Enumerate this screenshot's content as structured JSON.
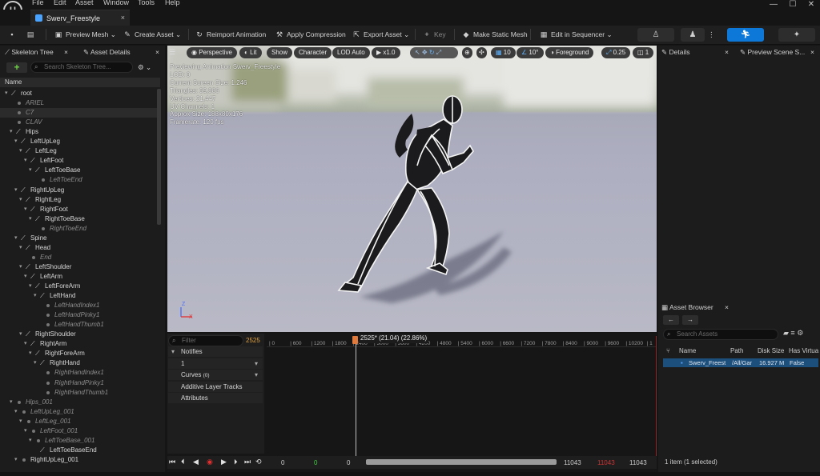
{
  "menu": [
    "File",
    "Edit",
    "Asset",
    "Window",
    "Tools",
    "Help"
  ],
  "app": {
    "logo": "U"
  },
  "window_controls": {
    "minimize": "—",
    "maximize": "☐",
    "close": "✕"
  },
  "document_tab": {
    "title": "Swerv_Freestyle",
    "close": "×"
  },
  "toolbar": {
    "save_icon": "floppy-icon",
    "preview_mesh": "Preview Mesh",
    "create_asset": "Create Asset",
    "reimport": "Reimport Animation",
    "apply_compression": "Apply Compression",
    "export_asset": "Export Asset",
    "key": "Key",
    "make_static_mesh": "Make Static Mesh",
    "edit_in_sequencer": "Edit in Sequencer"
  },
  "left_panel": {
    "tab_skeleton": "Skeleton Tree",
    "tab_details": "Asset Details",
    "search_placeholder": "Search Skeleton Tree...",
    "add_label": "+",
    "column_name": "Name",
    "tree": [
      {
        "label": "root",
        "depth": 0,
        "kind": "bone",
        "expand": true
      },
      {
        "label": "ARIEL",
        "depth": 1,
        "kind": "dot"
      },
      {
        "label": "C7",
        "depth": 1,
        "kind": "dot",
        "selected": true
      },
      {
        "label": "CLAV",
        "depth": 1,
        "kind": "dot"
      },
      {
        "label": "Hips",
        "depth": 1,
        "kind": "bone",
        "expand": true
      },
      {
        "label": "LeftUpLeg",
        "depth": 2,
        "kind": "bone",
        "expand": true
      },
      {
        "label": "LeftLeg",
        "depth": 3,
        "kind": "bone",
        "expand": true
      },
      {
        "label": "LeftFoot",
        "depth": 4,
        "kind": "bone",
        "expand": true
      },
      {
        "label": "LeftToeBase",
        "depth": 5,
        "kind": "bone",
        "expand": true
      },
      {
        "label": "LeftToeEnd",
        "depth": 6,
        "kind": "dot"
      },
      {
        "label": "RightUpLeg",
        "depth": 2,
        "kind": "bone",
        "expand": true
      },
      {
        "label": "RightLeg",
        "depth": 3,
        "kind": "bone",
        "expand": true
      },
      {
        "label": "RightFoot",
        "depth": 4,
        "kind": "bone",
        "expand": true
      },
      {
        "label": "RightToeBase",
        "depth": 5,
        "kind": "bone",
        "expand": true
      },
      {
        "label": "RightToeEnd",
        "depth": 6,
        "kind": "dot"
      },
      {
        "label": "Spine",
        "depth": 2,
        "kind": "bone",
        "expand": true
      },
      {
        "label": "Head",
        "depth": 3,
        "kind": "bone",
        "expand": true
      },
      {
        "label": "End",
        "depth": 4,
        "kind": "dot"
      },
      {
        "label": "LeftShoulder",
        "depth": 3,
        "kind": "bone",
        "expand": true
      },
      {
        "label": "LeftArm",
        "depth": 4,
        "kind": "bone",
        "expand": true
      },
      {
        "label": "LeftForeArm",
        "depth": 5,
        "kind": "bone",
        "expand": true
      },
      {
        "label": "LeftHand",
        "depth": 6,
        "kind": "bone",
        "expand": true
      },
      {
        "label": "LeftHandIndex1",
        "depth": 7,
        "kind": "dot"
      },
      {
        "label": "LeftHandPinky1",
        "depth": 7,
        "kind": "dot"
      },
      {
        "label": "LeftHandThumb1",
        "depth": 7,
        "kind": "dot"
      },
      {
        "label": "RightShoulder",
        "depth": 3,
        "kind": "bone",
        "expand": true
      },
      {
        "label": "RightArm",
        "depth": 4,
        "kind": "bone",
        "expand": true
      },
      {
        "label": "RightForeArm",
        "depth": 5,
        "kind": "bone",
        "expand": true
      },
      {
        "label": "RightHand",
        "depth": 6,
        "kind": "bone",
        "expand": true
      },
      {
        "label": "RightHandIndex1",
        "depth": 7,
        "kind": "dot"
      },
      {
        "label": "RightHandPinky1",
        "depth": 7,
        "kind": "dot"
      },
      {
        "label": "RightHandThumb1",
        "depth": 7,
        "kind": "dot"
      },
      {
        "label": "Hips_001",
        "depth": 1,
        "kind": "dot",
        "expand": true
      },
      {
        "label": "LeftUpLeg_001",
        "depth": 2,
        "kind": "dot",
        "expand": true
      },
      {
        "label": "LeftLeg_001",
        "depth": 3,
        "kind": "dot",
        "expand": true
      },
      {
        "label": "LeftFoot_001",
        "depth": 4,
        "kind": "dot",
        "expand": true
      },
      {
        "label": "LeftToeBase_001",
        "depth": 5,
        "kind": "dot",
        "expand": true
      },
      {
        "label": "LeftToeBaseEnd",
        "depth": 6,
        "kind": "bone",
        "plain": true
      },
      {
        "label": "RightUpLeg_001",
        "depth": 2,
        "kind": "dot",
        "expand": true,
        "plain": true
      }
    ]
  },
  "viewport": {
    "menu_icon": "hamburger-icon",
    "perspective": "Perspective",
    "lit": "Lit",
    "show": "Show",
    "character": "Character",
    "lod": "LOD Auto",
    "speed": "x1.0",
    "grid_value": "10",
    "angle_value": "10°",
    "foreground": "Foreground",
    "scale_value": "0.25",
    "cams_value": "1",
    "stats": [
      "Previewing Animation Swerv_Freestyle",
      "LOD: 0",
      "Current Screen Size: 1.246",
      "Triangles: 39,886",
      "Vertices: 21,447",
      "UV Channels: 1",
      "Approx Size: 188x80x176",
      "Framerate: 120 fps"
    ],
    "axis_z": "Z",
    "axis_x": "X"
  },
  "right_panel": {
    "tab_details": "Details",
    "tab_preview": "Preview Scene S..."
  },
  "asset_browser": {
    "tab": "Asset Browser",
    "search_placeholder": "Search Assets",
    "col_name": "Name",
    "col_path": "Path",
    "col_disk": "Disk Size",
    "col_virtual": "Has Virtua",
    "row": {
      "name": "Swerv_Freest",
      "path": "/All/Gar",
      "disk": "16.927 M",
      "virtual": "False"
    },
    "status": "1 item (1 selected)"
  },
  "timeline": {
    "filter_placeholder": "Filter",
    "frame": "2525",
    "notifies": "Notifies",
    "notify_track": "1",
    "curves": "Curves",
    "curves_count": "(0)",
    "additive": "Additive Layer Tracks",
    "attributes": "Attributes",
    "playhead_label": "2525* (21.04) (22.86%)",
    "ticks": [
      "0",
      "600",
      "1200",
      "1800",
      "2400",
      "3000",
      "3600",
      "4200",
      "4800",
      "5400",
      "6000",
      "6600",
      "7200",
      "7800",
      "8400",
      "9000",
      "9600",
      "10200",
      "1"
    ],
    "start_a": "0",
    "start_b": "0",
    "start_c": "0",
    "end_a": "11043",
    "end_b": "11043",
    "end_c": "11043"
  },
  "colors": {
    "accent": "#0e78d8",
    "playhead": "#e07a3c",
    "selection": "#1d4f7c"
  }
}
